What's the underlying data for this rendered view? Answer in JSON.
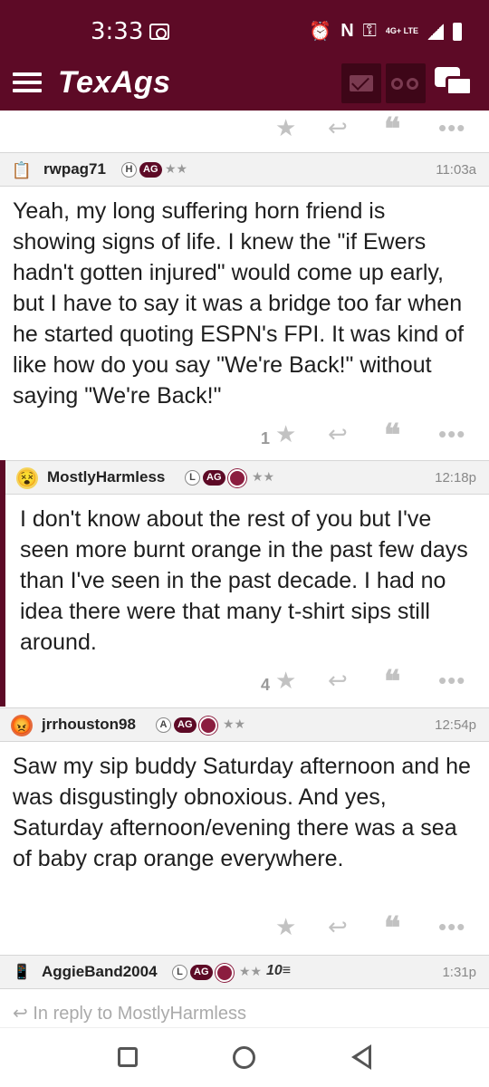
{
  "status_bar": {
    "time": "3:33",
    "network": "4G+ LTE",
    "icons": [
      "screen-record-icon",
      "alarm-icon",
      "nfc-icon",
      "key-icon",
      "signal-icon",
      "battery-icon"
    ]
  },
  "app_bar": {
    "logo": "TexAgs",
    "icons": [
      "menu-icon",
      "mail-icon",
      "binoculars-icon",
      "chat-icon"
    ]
  },
  "colors": {
    "maroon": "#5d0a26",
    "header_bg": "#f2f2f2",
    "action_gray": "#c2c2c2"
  },
  "actions": {
    "star": "★",
    "reply": "↩",
    "quote": "❝",
    "more": "•••"
  },
  "posts": [
    {
      "username": "rwpag71",
      "avatar": "notepad-icon",
      "badges": [
        "H",
        "AG"
      ],
      "stars": "★★",
      "time": "11:03a",
      "body": "Yeah, my long suffering horn friend is showing signs of life. I knew the \"if Ewers hadn't gotten injured\" would come up early, but I have to say it was a bridge too far when he started quoting ESPN's FPI. It was kind of like how do you say \"We're Back!\" without saying \"We're Back!\"",
      "star_count": "1"
    },
    {
      "username": "MostlyHarmless",
      "avatar": "dizzy-face-icon",
      "badges": [
        "L",
        "AG",
        "seal"
      ],
      "stars": "★★",
      "time": "12:18p",
      "body": "I don't know about the rest of you but I've seen more burnt orange in the past few days than I've seen in the past decade. I had no idea there were that many t-shirt sips still around.",
      "star_count": "4"
    },
    {
      "username": "jrrhouston98",
      "avatar": "angry-face-icon",
      "badges": [
        "A",
        "AG",
        "seal"
      ],
      "stars": "★★",
      "time": "12:54p",
      "body": "Saw my sip buddy Saturday afternoon and he was disgustingly obnoxious. And yes, Saturday afternoon/evening there was a sea of baby crap orange everywhere.",
      "star_count": ""
    },
    {
      "username": "AggieBand2004",
      "avatar": "phone-icon",
      "badges": [
        "L",
        "AG",
        "seal"
      ],
      "stars": "★★",
      "extra": "10≡",
      "time": "1:31p",
      "reply_to": "In reply to MostlyHarmless"
    }
  ]
}
